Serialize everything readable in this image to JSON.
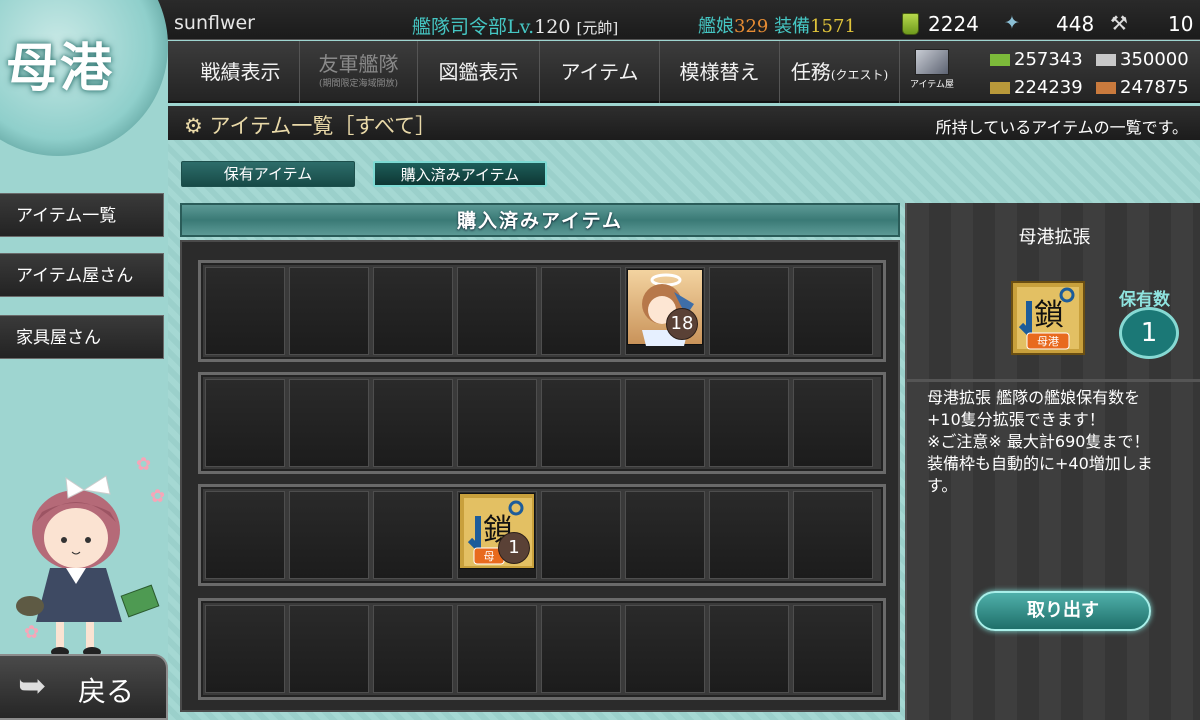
{
  "header": {
    "username": "sunflwer",
    "hq_label": "艦隊司令部",
    "level_prefix": "Lv.",
    "level": "120",
    "rank": "[元帥]",
    "ships_label": "艦娘",
    "ships_count": "329",
    "equip_label": "装備",
    "equip_count": "1571",
    "buckets": "2224",
    "build_materials": "448",
    "dev_materials": "10"
  },
  "menu": {
    "items": [
      "戦績表示",
      "友軍艦隊",
      "図鑑表示",
      "アイテム",
      "模様替え",
      "任務"
    ],
    "friend_fleet_sub": "(期間限定海域開放)",
    "quest_sub": "(クエスト)",
    "shop_label": "アイテム屋"
  },
  "resources": {
    "fuel": "257343",
    "steel": "350000",
    "ammo": "224239",
    "bauxite": "247875"
  },
  "logo": {
    "text": "母港"
  },
  "subheader": {
    "title": "アイテム一覧［すべて］",
    "description": "所持しているアイテムの一覧です。"
  },
  "sidebar": {
    "items": [
      "アイテム一覧",
      "アイテム屋さん",
      "家具屋さん"
    ],
    "back_label": "戻る"
  },
  "tabs": {
    "owned": "保有アイテム",
    "purchased": "購入済みアイテム"
  },
  "section_title": "購入済みアイテム",
  "shelf": {
    "items": [
      {
        "row": 0,
        "col": 5,
        "name": "mamiya-item",
        "count": "18"
      },
      {
        "row": 2,
        "col": 3,
        "name": "port-expansion-item",
        "count": "1"
      }
    ]
  },
  "detail": {
    "name": "母港拡張",
    "icon_kanji": "鎖",
    "icon_label": "母港",
    "owned_label": "保有数",
    "owned_count": "1",
    "description": "母港拡張 艦隊の艦娘保有数を\n+10隻分拡張できます！\n※ご注意※ 最大計690隻まで！\n装備枠も自動的に+40増加しま\nす。",
    "take_out_label": "取り出す"
  },
  "colors": {
    "accent_teal": "#45c6c3",
    "ship_count": "#e58b33",
    "equip_count": "#e0c43a",
    "background": "#9ed5d0"
  }
}
